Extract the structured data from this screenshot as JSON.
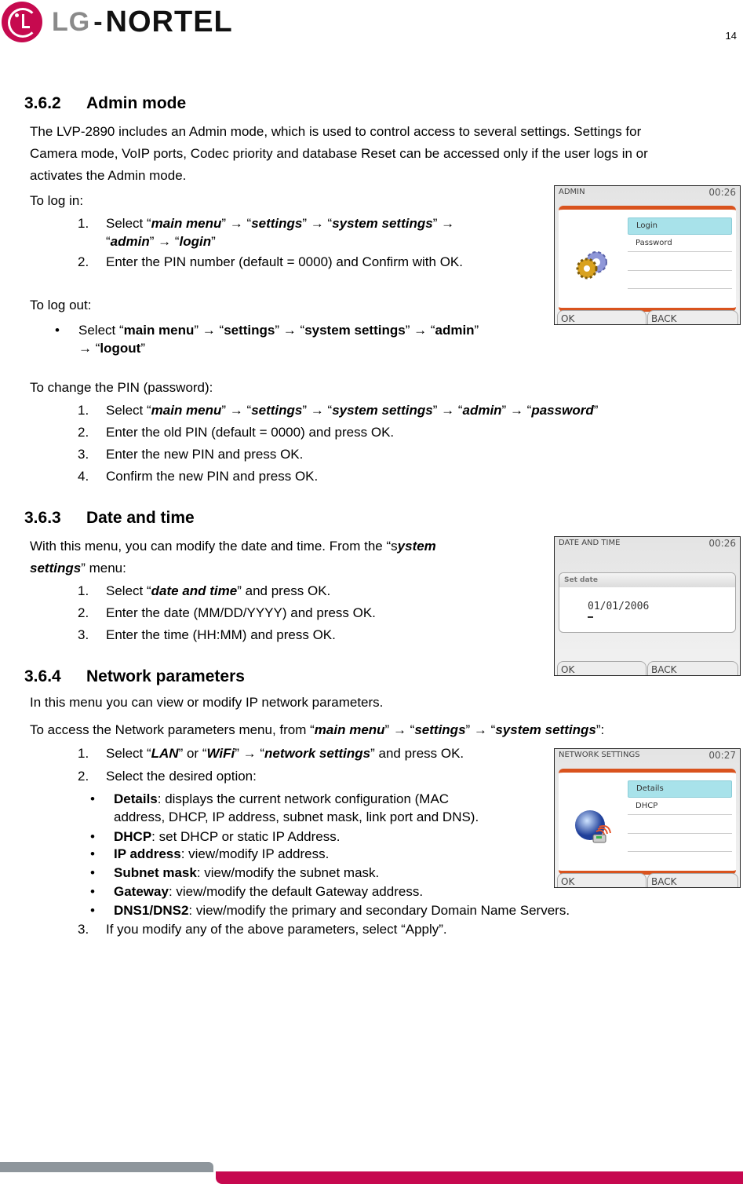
{
  "header": {
    "logo_lg": "LG",
    "logo_dash": "-",
    "logo_nortel": "NORTEL",
    "page_number": "14"
  },
  "sections": {
    "admin": {
      "number": "3.6.2",
      "title": "Admin mode",
      "intro_1": "The LVP-2890 includes an Admin mode, which is used to control access to several settings.  Settings for",
      "intro_2": "Camera mode, VoIP ports, Codec priority and database Reset can be accessed only if the user logs in or",
      "intro_3": "activates the Admin mode.",
      "login_label": "To log in:",
      "login_step1_num": "1.",
      "login_step2_num": "2.",
      "login_step2": "Enter the PIN number (default = 0000) and Confirm with OK.",
      "logout_label": "To log out:",
      "change_pin_label": "To change the PIN (password):",
      "change_steps": [
        {
          "num": "1."
        },
        {
          "num": "2.",
          "text": "Enter the old PIN (default = 0000) and press OK."
        },
        {
          "num": "3.",
          "text": "Enter the new PIN and press OK."
        },
        {
          "num": "4.",
          "text": "Confirm the new PIN and press OK."
        }
      ],
      "terms": {
        "select": "Select ",
        "main_menu": "main menu",
        "settings": "settings",
        "system_settings": "system settings",
        "admin": "admin",
        "login": "login",
        "logout": "logout",
        "password": "password",
        "arrow": " → ",
        "lq": "“",
        "rq": "”"
      }
    },
    "datetime": {
      "number": "3.6.3",
      "title": "Date and time",
      "intro_a": "With this menu, you can modify the date and time.  From the “s",
      "intro_b": "ystem",
      "intro_c": "settings",
      "intro_d": "” menu:",
      "steps": [
        {
          "num": "1.",
          "a": "Select “",
          "b": "date and time",
          "c": "” and press OK."
        },
        {
          "num": "2.",
          "text": "Enter the date (MM/DD/YYYY) and press OK."
        },
        {
          "num": "3.",
          "text": "Enter the time (HH:MM) and press OK."
        }
      ]
    },
    "network": {
      "number": "3.6.4",
      "title": "Network parameters",
      "intro": "In this menu you can view or modify IP network parameters.",
      "access_a": "To access the Network parameters menu, from “",
      "access_tail": "”:",
      "step1": {
        "num": "1.",
        "a": "Select “",
        "lan": "LAN",
        "or": "” or “",
        "wifi": "WiFi",
        "ns": "network settings",
        "tail": "” and press OK."
      },
      "step2": {
        "num": "2.",
        "text": "Select the desired option:"
      },
      "options": [
        {
          "term": "Details",
          "desc": ": displays the current network configuration (MAC",
          "desc2": "address, DHCP, IP address, subnet mask, link port and DNS)."
        },
        {
          "term": "DHCP",
          "desc": ": set DHCP or static IP Address."
        },
        {
          "term": "IP address",
          "desc": ": view/modify IP address."
        },
        {
          "term": "Subnet mask",
          "desc": ": view/modify the subnet mask."
        },
        {
          "term": "Gateway",
          "desc": ": view/modify the default Gateway address."
        },
        {
          "term": "DNS1/DNS2",
          "desc": ": view/modify the primary and secondary Domain Name Servers."
        }
      ],
      "step3": {
        "num": "3.",
        "text": "If you modify any of the above parameters, select “Apply”."
      }
    }
  },
  "screens": {
    "admin": {
      "title": "ADMIN",
      "time": "00:26",
      "items": [
        "Login",
        "Password"
      ],
      "ok": "OK",
      "back": "BACK"
    },
    "datetime": {
      "title": "DATE AND TIME",
      "time": "00:26",
      "field_label": "Set date",
      "value": "01/01/2006",
      "ok": "OK",
      "back": "BACK"
    },
    "network": {
      "title": "NETWORK SETTINGS",
      "time": "00:27",
      "items": [
        "Details",
        "DHCP"
      ],
      "ok": "OK",
      "back": "BACK"
    }
  },
  "colors": {
    "brand_red": "#c6084f",
    "footer_gray": "#8e969c",
    "screen_accent": "#d9531e",
    "selection": "#a8e2ea"
  }
}
